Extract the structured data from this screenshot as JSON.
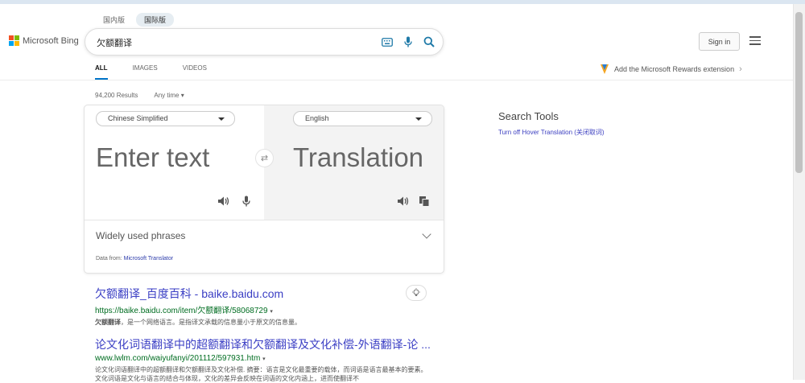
{
  "region_tabs": [
    "国内版",
    "国际版"
  ],
  "logo": {
    "text": "Microsoft Bing",
    "colors": [
      "#f25022",
      "#7fba00",
      "#00a4ef",
      "#ffb900"
    ]
  },
  "search": {
    "query": "欠额翻译"
  },
  "header": {
    "signin": "Sign in"
  },
  "nav": {
    "tabs": [
      "ALL",
      "IMAGES",
      "VIDEOS"
    ],
    "active": "ALL"
  },
  "rewards": {
    "text": "Add the Microsoft Rewards extension"
  },
  "meta": {
    "results": "94,200 Results",
    "time_filter": "Any time"
  },
  "translator": {
    "source_lang": "Chinese Simplified",
    "target_lang": "English",
    "input_placeholder": "Enter text",
    "output_placeholder": "Translation",
    "phrases_label": "Widely used phrases",
    "data_from_prefix": "Data from: ",
    "data_from_link": "Microsoft Translator"
  },
  "search_tools": {
    "title": "Search Tools",
    "link": "Turn off Hover Translation (关闭取词)"
  },
  "results": [
    {
      "title": "欠额翻译_百度百科 - baike.baidu.com",
      "url": "https://baike.baidu.com/item/欠额翻译/58068729",
      "snippet_bold": "欠额翻译",
      "snippet": "，是一个网络语言。是指译文承载的信息量小于原文的信息量。"
    },
    {
      "title": "论文化词语翻译中的超额翻译和欠额翻译及文化补偿-外语翻译-论 ...",
      "url": "www.lwlm.com/waiyufanyi/201112/597931.htm",
      "snippet": "论文化词语翻译中的超额翻译和欠额翻译及文化补偿. 摘要：语言是文化最重要的载体，而词语是语言最基本的要素。文化词语是文化与语言的结合与体现，文化的差异会反映在词语的文化内涵上，进而使翻译不"
    }
  ]
}
